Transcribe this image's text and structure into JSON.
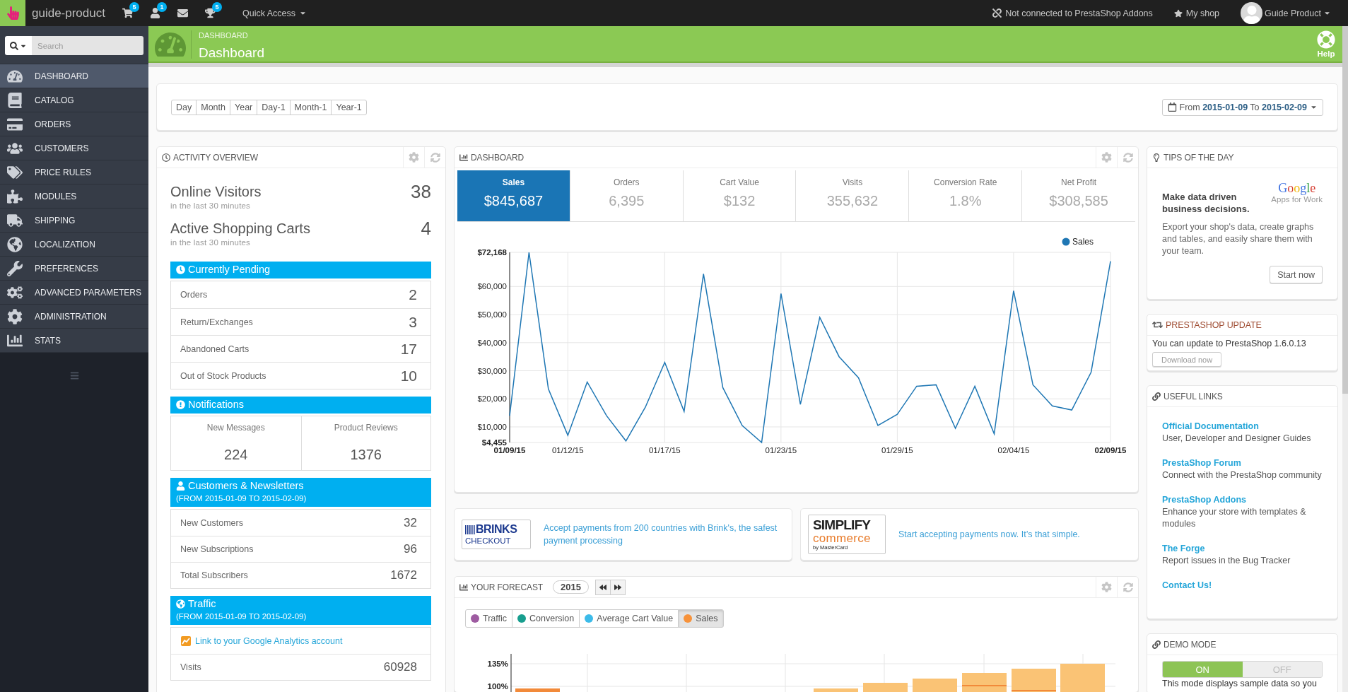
{
  "top_bar": {
    "shop_name": "guide-product",
    "shortcuts": [
      {
        "kind": "cart",
        "badge": "5"
      },
      {
        "kind": "customer",
        "badge": "1"
      },
      {
        "kind": "message"
      },
      {
        "kind": "trophy",
        "badge": "5"
      }
    ],
    "quick_access": "Quick Access",
    "addons_status": "Not connected to PrestaShop Addons",
    "my_shop": "My shop",
    "user": "Guide Product"
  },
  "sidebar": {
    "search": {
      "placeholder": "Search"
    },
    "items": [
      {
        "kind": "dashboard",
        "label": "DASHBOARD",
        "selected": true
      },
      {
        "kind": "catalog",
        "label": "CATALOG",
        "selected": false
      },
      {
        "kind": "orders",
        "label": "ORDERS",
        "selected": false
      },
      {
        "kind": "customers",
        "label": "CUSTOMERS",
        "selected": false
      },
      {
        "kind": "price_rules",
        "label": "PRICE RULES",
        "selected": false
      },
      {
        "kind": "modules",
        "label": "MODULES",
        "selected": false
      },
      {
        "kind": "shipping",
        "label": "SHIPPING",
        "selected": false
      },
      {
        "kind": "localization",
        "label": "LOCALIZATION",
        "selected": false
      },
      {
        "kind": "preferences",
        "label": "PREFERENCES",
        "selected": false
      },
      {
        "kind": "advanced",
        "label": "ADVANCED PARAMETERS",
        "selected": false
      },
      {
        "kind": "administration",
        "label": "ADMINISTRATION",
        "selected": false
      },
      {
        "kind": "stats",
        "label": "STATS",
        "selected": false
      }
    ]
  },
  "page_header": {
    "breadcrumb": "DASHBOARD",
    "title": "Dashboard",
    "help": "Help"
  },
  "toolbar": {
    "periods": [
      {
        "label": "Day",
        "selected": false
      },
      {
        "label": "Month",
        "selected": false
      },
      {
        "label": "Year",
        "selected": false
      },
      {
        "label": "Day-1",
        "selected": false
      },
      {
        "label": "Month-1",
        "selected": false
      },
      {
        "label": "Year-1",
        "selected": false
      }
    ],
    "date_range": "From **2015-01-09** To **2015-02-09**"
  },
  "activity_overview": {
    "title": "ACTIVITY OVERVIEW",
    "live": [
      {
        "label": "Online Visitors",
        "sublabel": "in the last 30 minutes",
        "value": "38"
      },
      {
        "label": "Active Shopping Carts",
        "sublabel": "in the last 30 minutes",
        "value": "4"
      }
    ],
    "sections": [
      {
        "kind": "pending",
        "title": "Currently Pending",
        "rows": [
          {
            "label": "Orders",
            "value": "2"
          },
          {
            "label": "Return/Exchanges",
            "value": "3"
          },
          {
            "label": "Abandoned Carts",
            "value": "17"
          },
          {
            "label": "Out of Stock Products",
            "value": "10"
          }
        ]
      },
      {
        "kind": "notifications",
        "title": "Notifications",
        "cells": [
          {
            "label": "New Messages",
            "value": "224"
          },
          {
            "label": "Product Reviews",
            "value": "1376"
          }
        ]
      },
      {
        "kind": "customers",
        "title": "Customers & Newsletters",
        "subtitle": "(FROM 2015-01-09 TO 2015-02-09)",
        "rows": [
          {
            "label": "New Customers",
            "value": "32"
          },
          {
            "label": "New Subscriptions",
            "value": "96"
          },
          {
            "label": "Total Subscribers",
            "value": "1672"
          }
        ]
      },
      {
        "kind": "traffic",
        "title": "Traffic",
        "subtitle": "(FROM 2015-01-09 TO 2015-02-09)",
        "link": "Link to your Google Analytics account",
        "rows": [
          {
            "label": "Visits",
            "value": "60928"
          }
        ]
      }
    ]
  },
  "dashboard": {
    "title": "DASHBOARD",
    "kpis": [
      {
        "label": "Sales",
        "value": "$845,687",
        "selected": true
      },
      {
        "label": "Orders",
        "value": "6,395",
        "selected": false
      },
      {
        "label": "Cart Value",
        "value": "$132",
        "selected": false
      },
      {
        "label": "Visits",
        "value": "355,632",
        "selected": false
      },
      {
        "label": "Conversion Rate",
        "value": "1.8%",
        "selected": false
      },
      {
        "label": "Net Profit",
        "value": "$308,585",
        "selected": false
      }
    ],
    "chart_data": {
      "type": "line",
      "categories": [
        "01/09/15",
        null,
        null,
        "01/12/15",
        null,
        null,
        null,
        null,
        "01/17/15",
        null,
        null,
        null,
        null,
        null,
        "01/23/15",
        null,
        null,
        null,
        null,
        null,
        "01/29/15",
        null,
        null,
        null,
        null,
        null,
        "02/04/15",
        null,
        null,
        null,
        null,
        "02/09/15"
      ],
      "series": [
        {
          "name": "Sales",
          "color": "#1f77b4",
          "values": [
            14000,
            72168,
            23500,
            7000,
            26000,
            14000,
            5000,
            17000,
            33000,
            15500,
            64500,
            24000,
            10500,
            4455,
            57500,
            18000,
            49000,
            35000,
            27500,
            10500,
            14500,
            24500,
            25000,
            9500,
            24500,
            7500,
            58500,
            25000,
            17500,
            16000,
            29500,
            69000
          ]
        }
      ],
      "ylim": [
        4455,
        72168
      ],
      "grid": true,
      "yticks": [
        {
          "value": 4455,
          "label": "$4,455"
        },
        {
          "value": 10000,
          "label": "$10,000"
        },
        {
          "value": 20000,
          "label": "$20,000"
        },
        {
          "value": 30000,
          "label": "$30,000"
        },
        {
          "value": 40000,
          "label": "$40,000"
        },
        {
          "value": 50000,
          "label": "$50,000"
        },
        {
          "value": 60000,
          "label": "$60,000"
        },
        {
          "value": 72168,
          "label": "$72,168"
        }
      ]
    }
  },
  "ads": [
    {
      "kind": "brinks",
      "logo": [
        "BRINKS",
        "CHECKOUT"
      ],
      "text": "Accept payments from 200 countries with Brink's, the safest payment processing"
    },
    {
      "kind": "simplify",
      "logo": [
        "SIMPLIFY",
        "commerce",
        "by MasterCard"
      ],
      "text": "Start accepting payments now. It’s that simple."
    }
  ],
  "forecast": {
    "title": "YOUR FORECAST",
    "year": "2015",
    "legend": [
      {
        "label": "Traffic",
        "color": "#9e5ba1",
        "selected": false
      },
      {
        "label": "Conversion",
        "color": "#179e8e",
        "selected": false
      },
      {
        "label": "Average Cart Value",
        "color": "#3cbbe9",
        "selected": false
      },
      {
        "label": "Sales",
        "color": "#f7923a",
        "selected": true
      }
    ],
    "y_tick_labels": [
      "135%",
      "100%"
    ]
  },
  "tips": {
    "title": "TIPS OF THE DAY",
    "logo": [
      "Google",
      "Apps for Work"
    ],
    "heading": "Make data driven business decisions.",
    "text": "Export your shop's data, create graphs and tables, and easily share them with your team.",
    "button": "Start now"
  },
  "update": {
    "title": "PRESTASHOP UPDATE",
    "text": "You can update to PrestaShop 1.6.0.13",
    "button": "Download now"
  },
  "useful_links": {
    "title": "USEFUL LINKS",
    "links": [
      {
        "label": "Official Documentation",
        "description": "User, Developer and Designer Guides"
      },
      {
        "label": "PrestaShop Forum",
        "description": "Connect with the PrestaShop community"
      },
      {
        "label": "PrestaShop Addons",
        "description": "Enhance your store with templates & modules"
      },
      {
        "label": "The Forge",
        "description": "Report issues in the Bug Tracker"
      },
      {
        "label": "Contact Us!"
      }
    ]
  },
  "demo_mode": {
    "title": "DEMO MODE",
    "options": [
      {
        "label": "ON",
        "selected": true
      },
      {
        "label": "OFF",
        "selected": false
      }
    ],
    "note": "This mode displays sample data so you"
  }
}
